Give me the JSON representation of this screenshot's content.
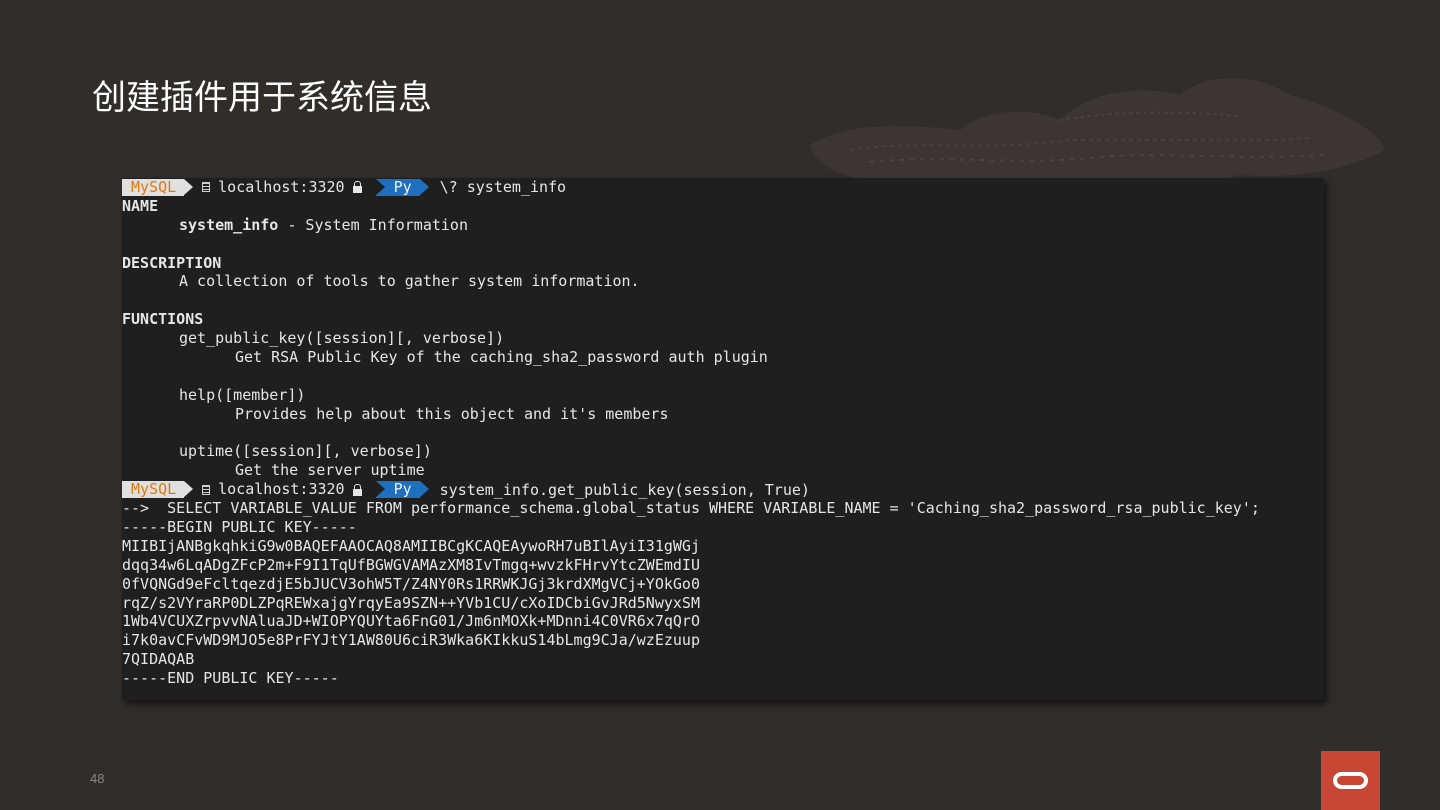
{
  "slide": {
    "title": "创建插件用于系统信息",
    "page_number": "48"
  },
  "colors": {
    "background": "#312d2a",
    "terminal_bg": "#1f1f1f",
    "mysql_segment": "#e0e0e0",
    "mysql_text": "#e07a10",
    "py_segment": "#1e6fc0",
    "oracle_red": "#c74634"
  },
  "icons": {
    "database": "database-icon",
    "lock": "lock-icon",
    "logo": "oracle-logo"
  },
  "terminal": {
    "prompt1": {
      "mysql": "MySQL",
      "host": "localhost:3320",
      "mode": "Py",
      "command": "\\? system_info"
    },
    "help": {
      "name_heading": "NAME",
      "name_cmd": "system_info",
      "name_desc": " - System Information",
      "desc_heading": "DESCRIPTION",
      "desc_text": "A collection of tools to gather system information.",
      "functions_heading": "FUNCTIONS",
      "functions": [
        {
          "signature": "get_public_key([session][, verbose])",
          "description": "Get RSA Public Key of the caching_sha2_password auth plugin"
        },
        {
          "signature": "help([member])",
          "description": "Provides help about this object and it's members"
        },
        {
          "signature": "uptime([session][, verbose])",
          "description": "Get the server uptime"
        }
      ]
    },
    "prompt2": {
      "mysql": "MySQL",
      "host": "localhost:3320",
      "mode": "Py",
      "command": "system_info.get_public_key(session, True)"
    },
    "output": [
      "-->  SELECT VARIABLE_VALUE FROM performance_schema.global_status WHERE VARIABLE_NAME = 'Caching_sha2_password_rsa_public_key';",
      "-----BEGIN PUBLIC KEY-----",
      "MIIBIjANBgkqhkiG9w0BAQEFAAOCAQ8AMIIBCgKCAQEAywoRH7uBIlAyiI31gWGj",
      "dqq34w6LqADgZFcP2m+F9I1TqUfBGWGVAMAzXM8IvTmgq+wvzkFHrvYtcZWEmdIU",
      "0fVQNGd9eFcltqezdjE5bJUCV3ohW5T/Z4NY0Rs1RRWKJGj3krdXMgVCj+YOkGo0",
      "rqZ/s2VYraRP0DLZPqREWxajgYrqyEa9SZN++YVb1CU/cXoIDCbiGvJRd5NwyxSM",
      "1Wb4VCUXZrpvvNAluaJD+WIOPYQUYta6FnG01/Jm6nMOXk+MDnni4C0VR6x7qQrO",
      "i7k0avCFvWD9MJO5e8PrFYJtY1AW80U6ciR3Wka6KIkkuS14bLmg9CJa/wzEzuup",
      "7QIDAQAB",
      "-----END PUBLIC KEY-----"
    ]
  }
}
